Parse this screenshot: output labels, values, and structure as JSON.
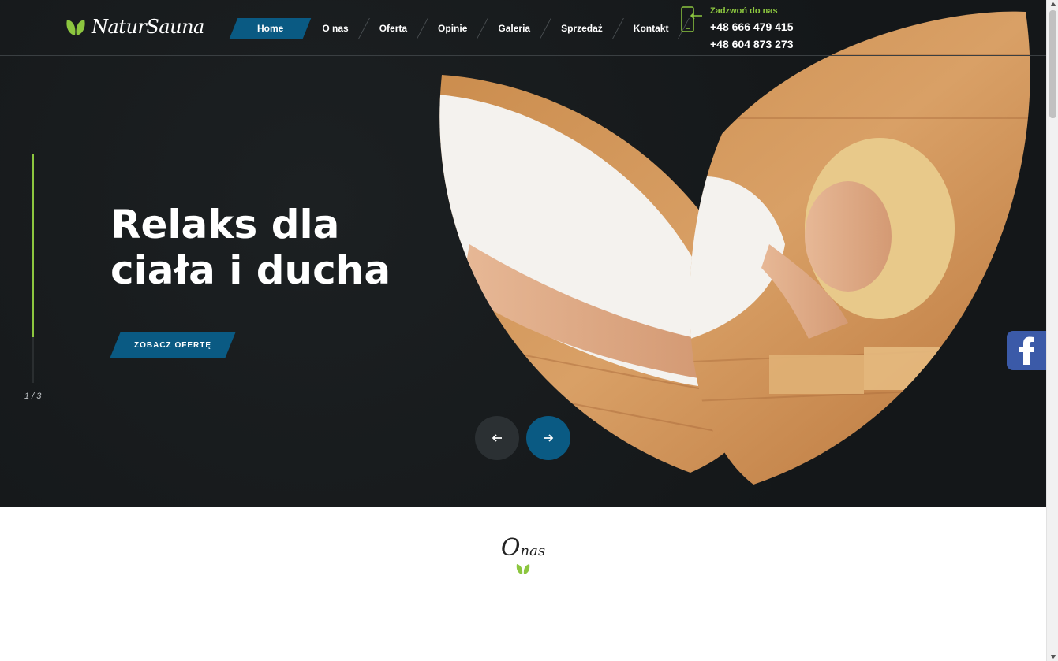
{
  "brand": {
    "name": "NaturSauna",
    "logo_icon": "leaf-icon"
  },
  "nav": {
    "items": [
      {
        "label": "Home",
        "active": true
      },
      {
        "label": "O nas",
        "active": false
      },
      {
        "label": "Oferta",
        "active": false
      },
      {
        "label": "Opinie",
        "active": false
      },
      {
        "label": "Galeria",
        "active": false
      },
      {
        "label": "Sprzedaż",
        "active": false
      },
      {
        "label": "Kontakt",
        "active": false
      }
    ]
  },
  "contact": {
    "label": "Zadzwoń do nas",
    "phones": [
      "+48 666 479 415",
      "+48 604 873 273"
    ],
    "icon": "phone-icon"
  },
  "hero": {
    "title_line1": "Relaks dla",
    "title_line2": "ciała i ducha",
    "cta_label": "ZOBACZ OFERTĘ",
    "slide_counter": "1 / 3",
    "progress_fraction": 0.8,
    "prev_icon": "arrow-left-icon",
    "next_icon": "arrow-right-icon"
  },
  "social": {
    "facebook_icon": "facebook-icon"
  },
  "about": {
    "title_big": "O",
    "title_small": "nas"
  },
  "colors": {
    "accent_blue": "#0a5a83",
    "accent_green": "#8cc63f",
    "hero_bg": "#16191b",
    "facebook": "#3b5aa8"
  }
}
